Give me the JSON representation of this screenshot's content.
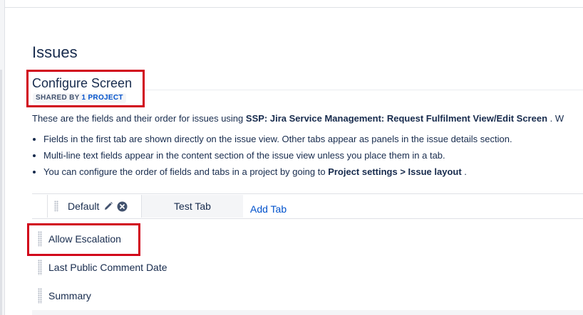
{
  "page": {
    "title": "Issues"
  },
  "screen": {
    "title": "Configure Screen",
    "shared_label": "SHARED BY",
    "shared_link": "1 PROJECT",
    "description_prefix": "These are the fields and their order for issues using",
    "description_screen": "SSP: Jira Service Management: Request Fulfilment View/Edit Screen",
    "description_suffix": ". W"
  },
  "notes": [
    {
      "text": "Fields in the first tab are shown directly on the issue view. Other tabs appear as panels in the issue details section."
    },
    {
      "text": "Multi-line text fields appear in the content section of the issue view unless you place them in a tab."
    },
    {
      "prefix": "You can configure the order of fields and tabs in a project by going to",
      "bold": "Project settings > Issue layout",
      "suffix": "."
    }
  ],
  "tabs": [
    {
      "label": "Default",
      "active": true
    },
    {
      "label": "Test Tab",
      "active": false
    }
  ],
  "add_tab_label": "Add Tab",
  "fields": [
    {
      "label": "Allow Escalation"
    },
    {
      "label": "Last Public Comment Date"
    },
    {
      "label": "Summary"
    }
  ],
  "icons": {
    "tab_edit": "pencil-icon",
    "tab_remove": "close-circle-icon",
    "drag_handle": "drag-handle-icon"
  },
  "colors": {
    "text": "#172b4d",
    "link": "#0052cc",
    "highlight": "#d1041a",
    "tab_inactive_bg": "#f4f5f7",
    "border": "#dfe1e6"
  }
}
